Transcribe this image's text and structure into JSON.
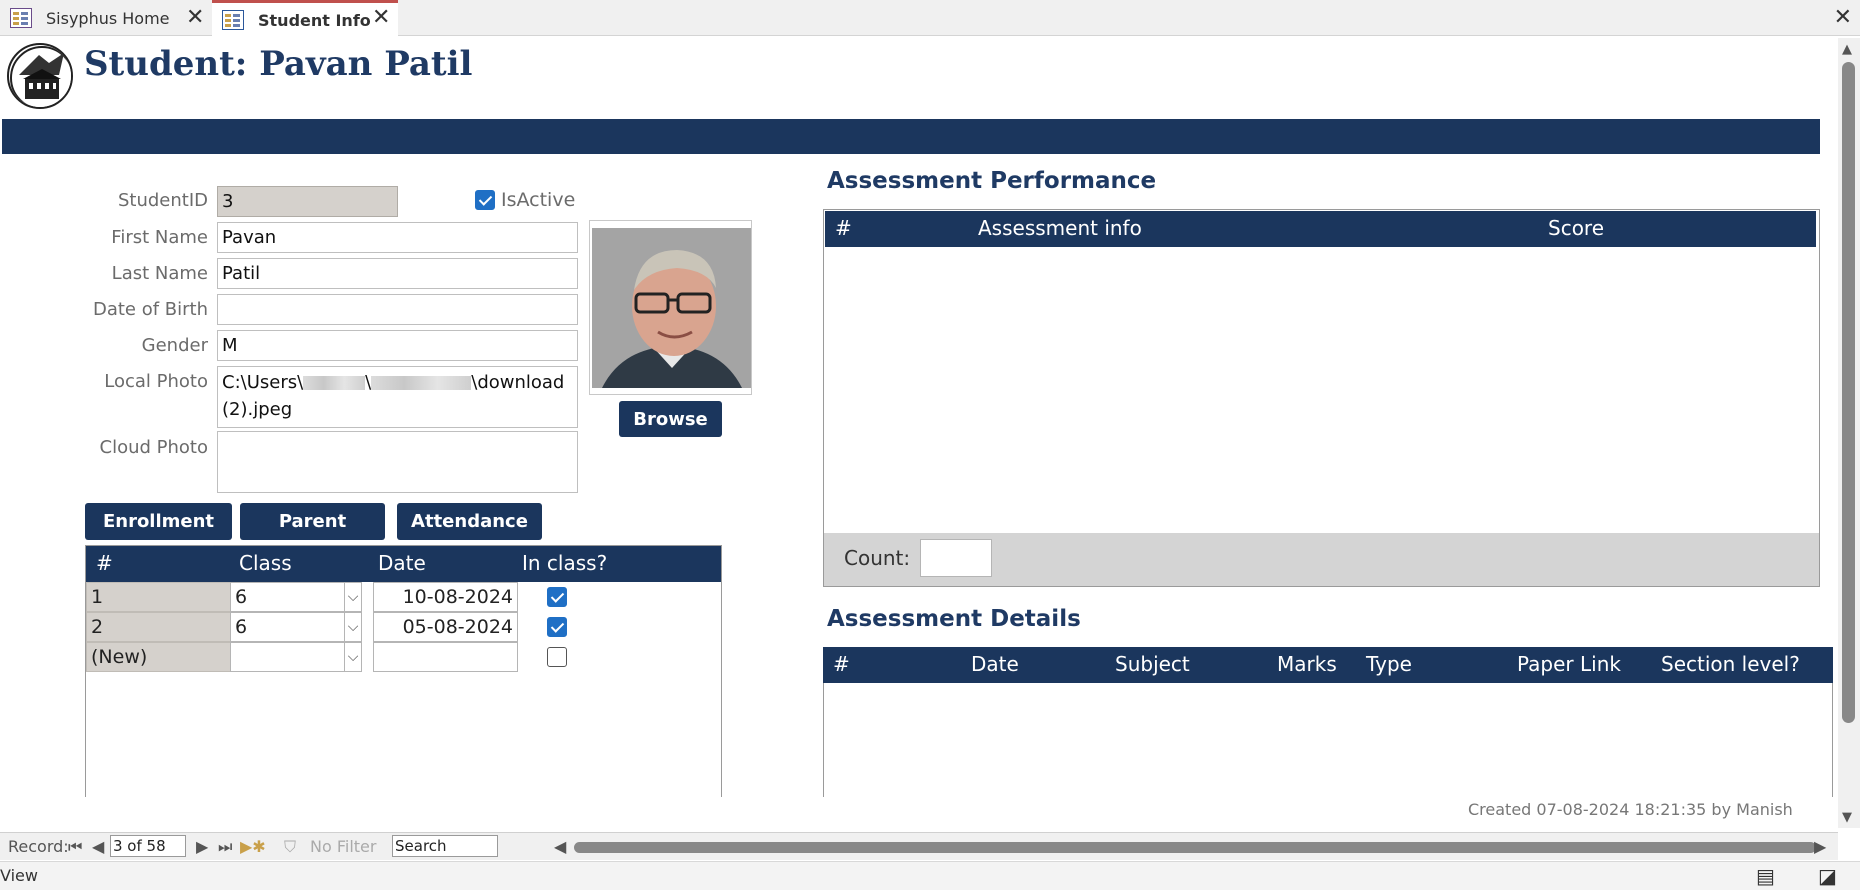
{
  "tabs": [
    {
      "label": "Sisyphus Home"
    },
    {
      "label": "Student Info"
    }
  ],
  "header": {
    "title": "Student: Pavan Patil"
  },
  "form": {
    "student_id_label": "StudentID",
    "student_id": "3",
    "is_active_label": "IsActive",
    "is_active": true,
    "first_name_label": "First Name",
    "first_name": "Pavan",
    "last_name_label": "Last Name",
    "last_name": "Patil",
    "dob_label": "Date of Birth",
    "dob": "",
    "gender_label": "Gender",
    "gender": "M",
    "local_photo_label": "Local Photo",
    "local_photo_start": "C:\\Users\\",
    "local_photo_mid": "\\",
    "local_photo_end": "\\download (2).jpeg",
    "cloud_photo_label": "Cloud Photo",
    "cloud_photo": ""
  },
  "buttons": {
    "browse": "Browse",
    "enrollment": "Enrollment",
    "parent": "Parent",
    "attendance": "Attendance"
  },
  "enrollment_grid": {
    "columns": [
      "#",
      "Class",
      "Date",
      "In class?"
    ],
    "rows": [
      {
        "num": "1",
        "class": "6",
        "date": "10-08-2024",
        "in_class": true
      },
      {
        "num": "2",
        "class": "6",
        "date": "05-08-2024",
        "in_class": true
      },
      {
        "num": "(New)",
        "class": "",
        "date": "",
        "in_class": false
      }
    ]
  },
  "assessment_performance": {
    "title": "Assessment Performance",
    "columns": [
      "#",
      "Assessment info",
      "Score"
    ],
    "count_label": "Count:",
    "count": ""
  },
  "assessment_details": {
    "title": "Assessment Details",
    "columns": [
      "#",
      "Date",
      "Subject",
      "Marks",
      "Type",
      "Paper Link",
      "Section level?"
    ]
  },
  "footer": {
    "created": "Created 07-08-2024 18:21:35 by Manish"
  },
  "navbar": {
    "record_label": "Record:",
    "record_value": "3 of 58",
    "filter_label": "No Filter",
    "search_placeholder": "Search"
  },
  "statusbar": {
    "view_label": "View"
  },
  "colors": {
    "accent": "#1b365d",
    "title": "#1f3a64",
    "checkbox": "#1f6fc5"
  }
}
